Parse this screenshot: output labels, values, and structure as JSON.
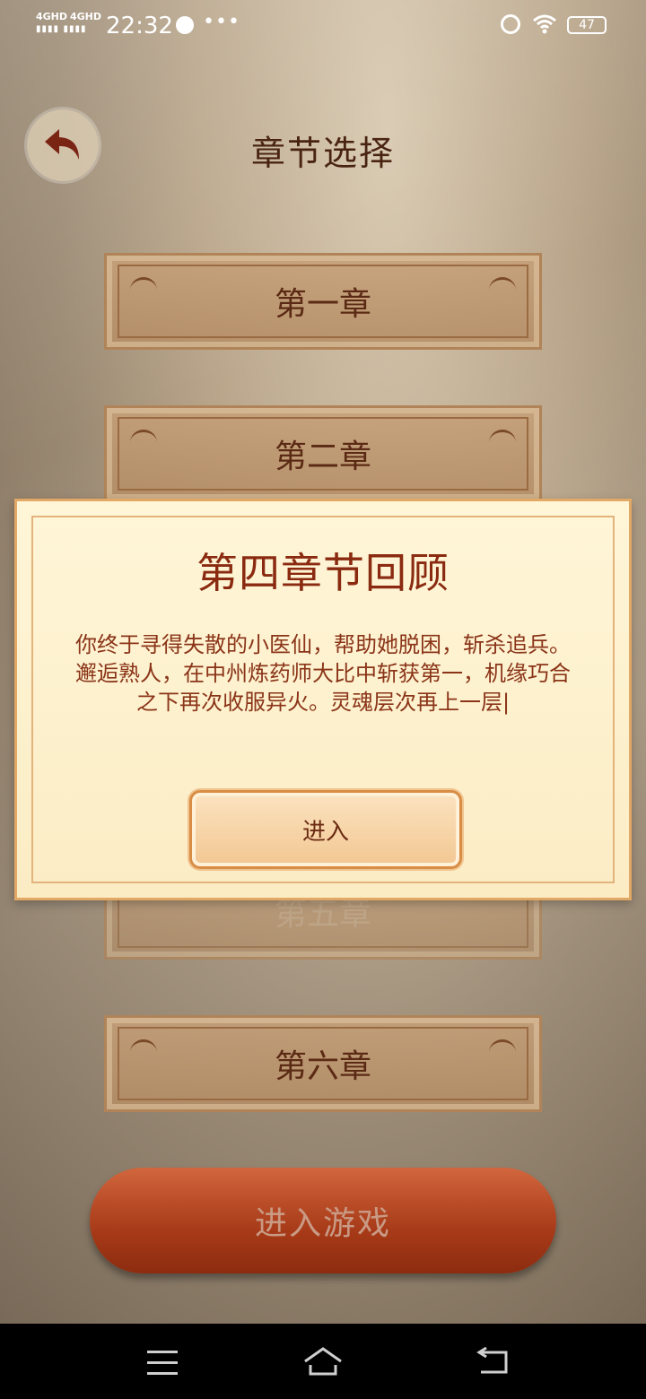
{
  "status_bar": {
    "signal1": "4GHD",
    "signal2": "4GHD",
    "time": "22:32",
    "battery": "47"
  },
  "header": {
    "title": "章节选择",
    "back_icon": "back-arrow-icon"
  },
  "chapters": [
    {
      "label": "第一章"
    },
    {
      "label": "第二章"
    },
    {
      "label": "第五章"
    },
    {
      "label": "第六章"
    }
  ],
  "modal": {
    "title": "第四章节回顾",
    "text": "你终于寻得失散的小医仙，帮助她脱困，斩杀追兵。邂逅熟人，在中州炼药师大比中斩获第一，机缘巧合之下再次收服异火。灵魂层次再上一层|",
    "enter_label": "进入"
  },
  "footer": {
    "play_label": "进入游戏"
  },
  "nav_bar": {
    "menu_icon": "menu-icon",
    "home_icon": "home-icon",
    "back_icon": "back-icon"
  }
}
